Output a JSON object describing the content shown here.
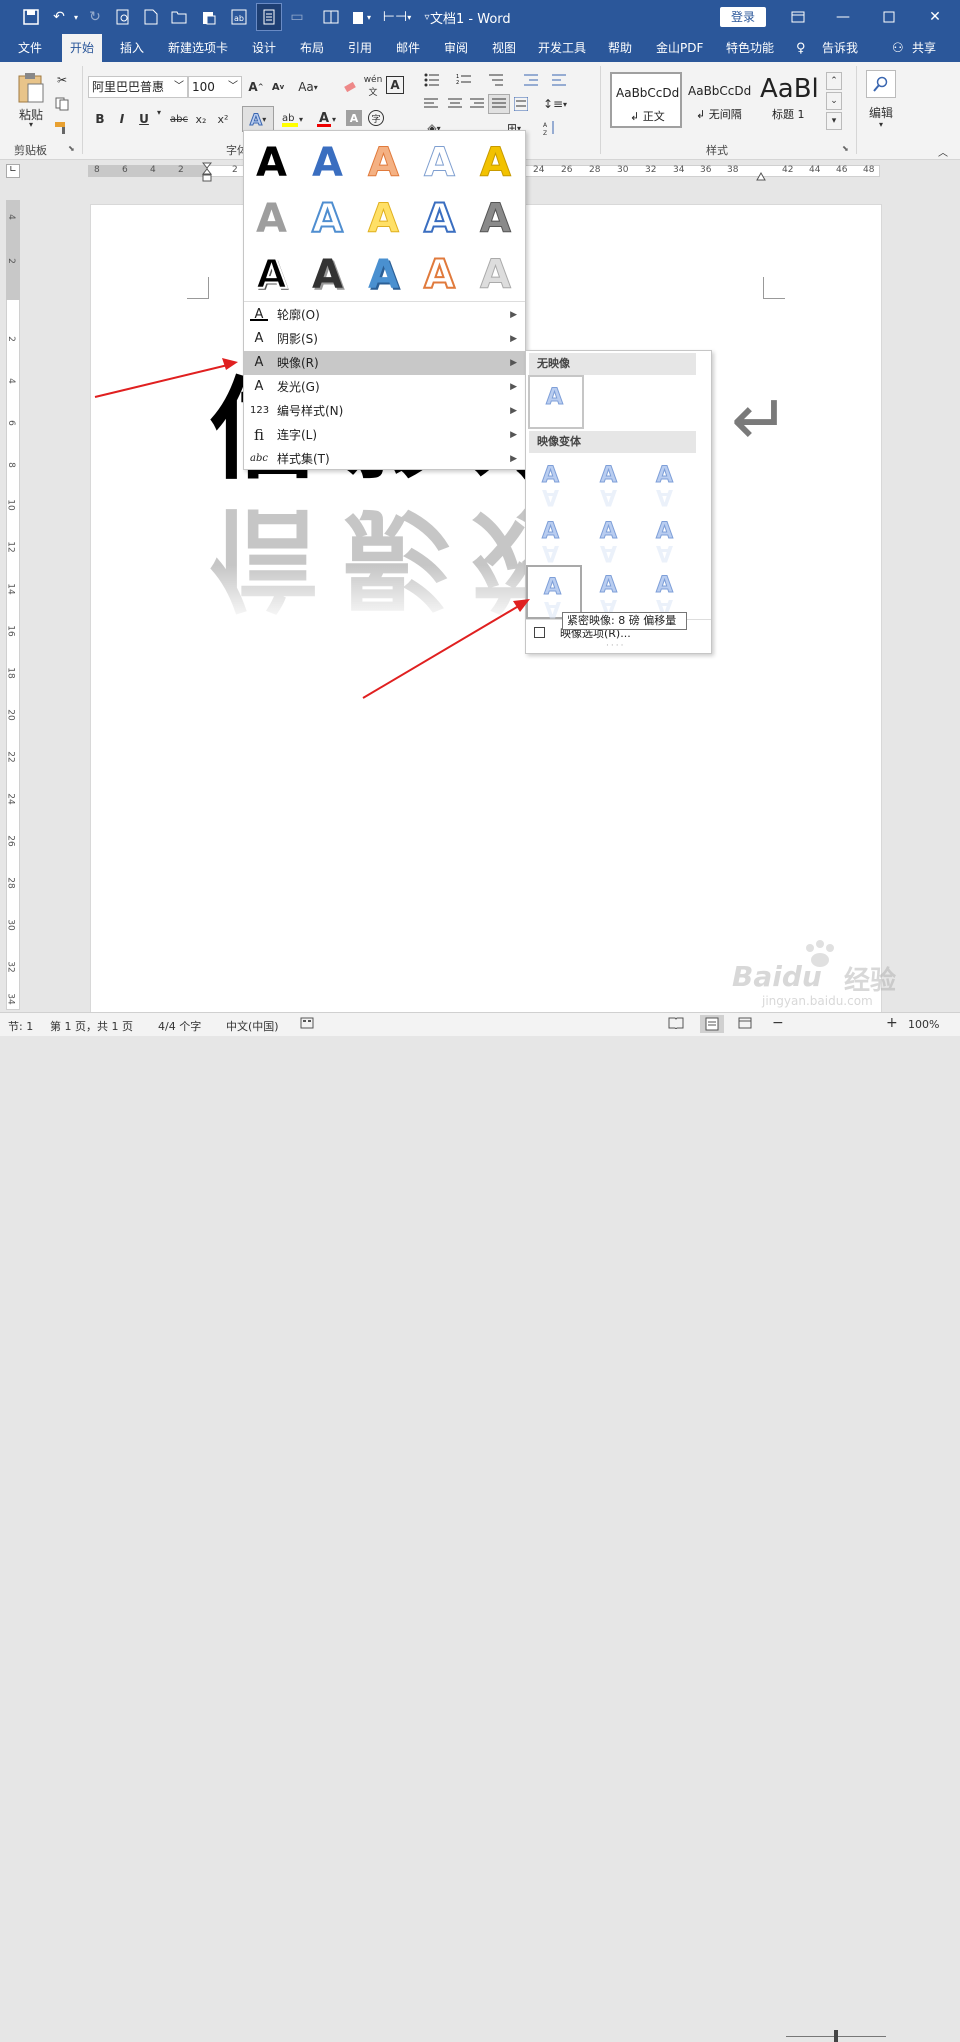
{
  "titlebar": {
    "doc_title": "文档1  -  Word",
    "login": "登录",
    "qat_icons": [
      "save-icon",
      "undo-icon",
      "redo-icon",
      "print-preview-icon",
      "new-doc-icon",
      "open-icon",
      "paste-icon",
      "format-icon",
      "read-mode-icon",
      "layout-icon",
      "table-icon",
      "spacing-icon",
      "customize-icon"
    ]
  },
  "tabs": [
    "文件",
    "开始",
    "插入",
    "新建选项卡",
    "设计",
    "布局",
    "引用",
    "邮件",
    "审阅",
    "视图",
    "开发工具",
    "帮助",
    "金山PDF",
    "特色功能",
    "告诉我",
    "共享"
  ],
  "ribbon": {
    "clipboard": {
      "label": "剪贴板",
      "paste": "粘贴"
    },
    "font": {
      "label": "字体",
      "font_name": "阿里巴巴普惠",
      "font_size": "100",
      "aa": "Aa",
      "bold": "B",
      "italic": "I",
      "underline": "U",
      "strike": "abc",
      "sub": "x₂",
      "sup": "x²",
      "phonetic": "wén"
    },
    "styles": {
      "label": "样式",
      "items": [
        {
          "preview": "AaBbCcDd",
          "name": "↲ 正文"
        },
        {
          "preview": "AaBbCcDd",
          "name": "↲ 无间隔"
        },
        {
          "preview": "AaBl",
          "name": "标题 1"
        }
      ]
    },
    "edit": {
      "label": "编辑"
    }
  },
  "ruler": {
    "h_numbers": [
      "8",
      "6",
      "4",
      "2",
      "2",
      "24",
      "26",
      "28",
      "30",
      "32",
      "34",
      "36",
      "38",
      "42",
      "44",
      "46",
      "48"
    ],
    "v_numbers": [
      "4",
      "2",
      "2",
      "4",
      "6",
      "8",
      "10",
      "12",
      "14",
      "16",
      "18",
      "20",
      "22",
      "24",
      "26",
      "28",
      "30",
      "32",
      "34"
    ]
  },
  "document": {
    "visible_chars": [
      "信",
      "影",
      "效",
      "果"
    ],
    "return_mark": "↵"
  },
  "text_effects_menu": {
    "items": [
      {
        "icon": "A",
        "label": "轮廓(O)"
      },
      {
        "icon": "A",
        "label": "阴影(S)"
      },
      {
        "icon": "A",
        "label": "映像(R)"
      },
      {
        "icon": "A",
        "label": "发光(G)"
      },
      {
        "icon": "123",
        "label": "编号样式(N)"
      },
      {
        "icon": "fi",
        "label": "连字(L)"
      },
      {
        "icon": "abc",
        "label": "样式集(T)"
      }
    ]
  },
  "reflection_menu": {
    "none_header": "无映像",
    "variants_header": "映像变体",
    "options_label": "映像选项(R)...",
    "tile_glyph": "A"
  },
  "tooltip": "紧密映像: 8 磅 偏移量",
  "statusbar": {
    "section": "节: 1",
    "page": "第 1 页，共 1 页",
    "words": "4/4 个字",
    "lang": "中文(中国)",
    "zoom": "100%"
  },
  "watermark": {
    "brand": "Baidu",
    "cn": "经验",
    "url": "jingyan.baidu.com"
  }
}
